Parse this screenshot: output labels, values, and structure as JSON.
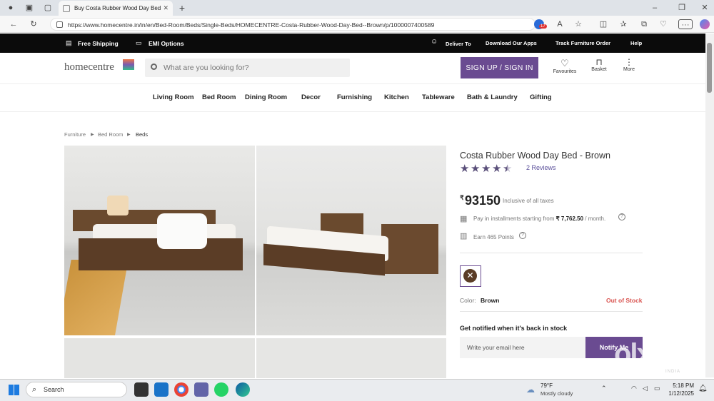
{
  "browser": {
    "tab_title": "Buy Costa Rubber Wood Day Bed",
    "new_tab": "+",
    "url": "https://www.homecentre.in/in/en/Bed-Room/Beds/Single-Beds/HOMECENTRE-Costa-Rubber-Wood-Day-Bed--Brown/p/1000007400589",
    "extension_badge": "17"
  },
  "topbar": {
    "free_shipping": "Free Shipping",
    "emi": "EMI Options",
    "deliver_to": "Deliver To",
    "download_apps": "Download Our Apps",
    "track_order": "Track Furniture Order",
    "help": "Help"
  },
  "header": {
    "logo": "homecentre",
    "search_placeholder": "What are you looking for?",
    "signup": "SIGN UP / SIGN IN",
    "favourites": "Favourites",
    "basket": "Basket",
    "more": "More"
  },
  "nav": [
    "Living Room",
    "Bed Room",
    "Dining Room",
    "Decor",
    "Furnishing",
    "Kitchen",
    "Tableware",
    "Bath & Laundry",
    "Gifting"
  ],
  "breadcrumb": [
    "Furniture",
    "Bed Room",
    "Beds"
  ],
  "product": {
    "title": "Costa Rubber Wood Day Bed - Brown",
    "rating": 4.5,
    "reviews": "2 Reviews",
    "currency": "₹",
    "price": "93150",
    "taxes": "Inclusive of all taxes",
    "installments_prefix": "Pay in installments starting from ",
    "installments_amount": "₹ 7,762.50",
    "installments_suffix": " / month.",
    "points": "Earn 465 Points",
    "color_label": "Color:",
    "color_value": "Brown",
    "stock": "Out of Stock",
    "notify_heading": "Get notified when it's back in stock",
    "email_placeholder": "Write your email here",
    "notify_button": "Notify Me"
  },
  "watermark": {
    "brand": "olx",
    "sub": "INDIA"
  },
  "taskbar": {
    "search": "Search",
    "weather_temp": "79°F",
    "weather_desc": "Mostly cloudy",
    "time": "5:18 PM",
    "date": "1/12/2025"
  },
  "colors": {
    "accent": "#6a4b91",
    "stock": "#d9534f",
    "topbar": "#0b0b0b"
  }
}
